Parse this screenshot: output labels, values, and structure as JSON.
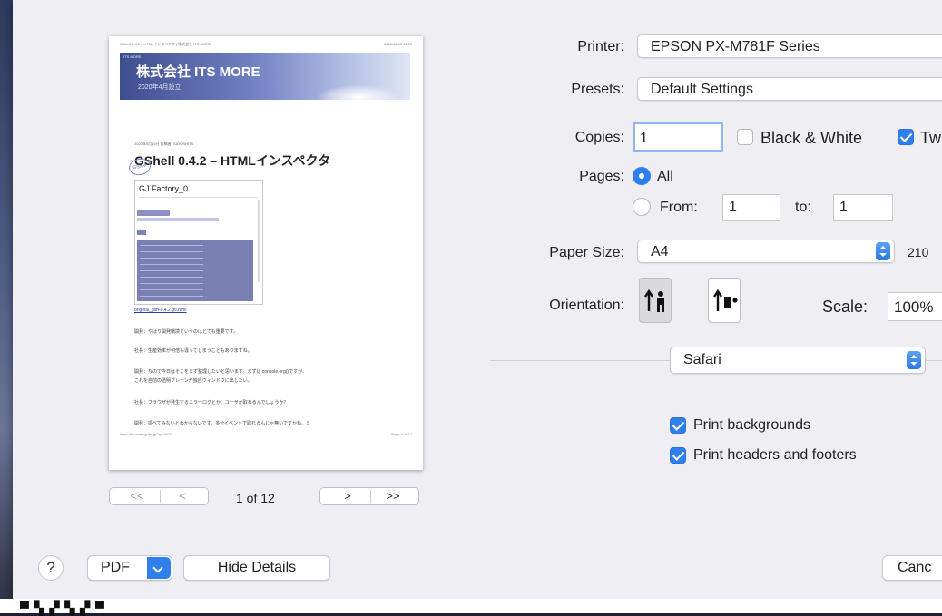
{
  "preview": {
    "header_left": "GShell 0.4.2 – HTMLインスペクタ | 株式会社 ITS MORE",
    "header_right": "2020/05/15 11:20",
    "banner_small": "ITS MORE",
    "banner_title": "株式会社 ITS MORE",
    "banner_sub": "2020年4月設立",
    "post_date": "2020年5月15日 投稿者: SATOSHITS",
    "post_title": "GShell 0.4.2 – HTMLインスペクタ",
    "stamp": "GShell",
    "window_title": "GJ Factory_0",
    "link": "original_gsh-0.4.2.go.html",
    "lines": [
      "開発：やはり開発環境というのはとても重要です。",
      "社長：生産効率が何倍も違ってしまうこともありますね。",
      "開発：なので今日はそこをまず整理したいと思います。まずは console.org()ですが、",
      "これを自前の透明ブレーンが独自ウィンドウに出したい。",
      "社長：ブラウザが発生するエラーログとか、ユーザが取れるんでしょうか？",
      "開発：調べてみないとわからないです。多分イベントで取れるんじゃ無いですかね。ミ"
    ],
    "footer_left": "https://its-more.jp/ja_jp/?p=1627",
    "footer_right": "Page 1 of 12"
  },
  "pager": {
    "first": "<<",
    "prev": "<",
    "next": ">",
    "last": ">>",
    "count": "1 of 12"
  },
  "form": {
    "printer_label": "Printer:",
    "printer_value": "EPSON PX-M781F Series",
    "presets_label": "Presets:",
    "presets_value": "Default Settings",
    "copies_label": "Copies:",
    "copies_value": "1",
    "bw_label": "Black & White",
    "two_sided_label": "Tw",
    "pages_label": "Pages:",
    "pages_all": "All",
    "pages_from": "From:",
    "from_value": "1",
    "to_label": "to:",
    "to_value": "1",
    "paper_label": "Paper Size:",
    "paper_value": "A4",
    "paper_dims": "210",
    "orientation_label": "Orientation:",
    "scale_label": "Scale:",
    "scale_value": "100%",
    "app_section": "Safari",
    "print_backgrounds": "Print backgrounds",
    "print_headers": "Print headers and footers"
  },
  "footer": {
    "help": "?",
    "pdf": "PDF",
    "hide_details": "Hide Details",
    "cancel": "Canc"
  },
  "colors": {
    "accent": "#2f80ed",
    "sheet": "#eeeef3"
  }
}
